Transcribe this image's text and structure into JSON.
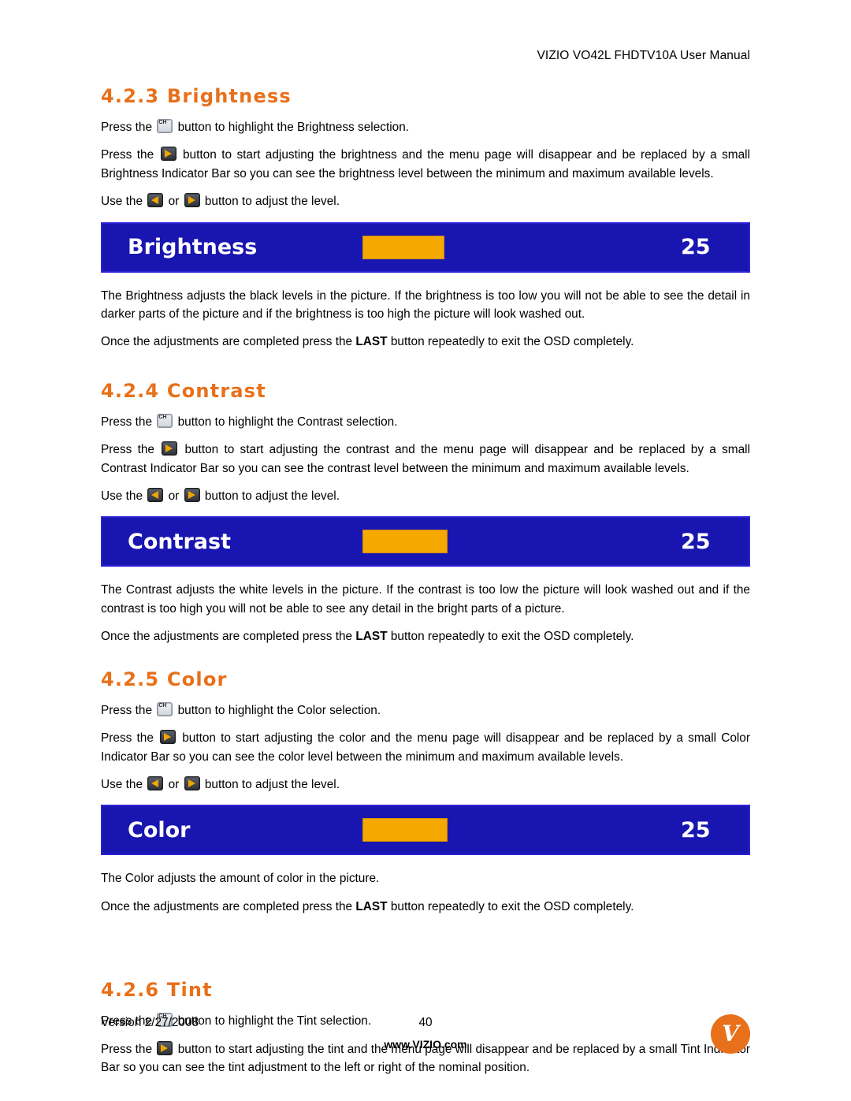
{
  "header": {
    "title": "VIZIO VO42L FHDTV10A User Manual"
  },
  "sections": [
    {
      "number_title": "4.2.3 Brightness",
      "p1_a": "Press the",
      "p1_b": "button to highlight the Brightness selection.",
      "p2_a": "Press the",
      "p2_b": "button to start adjusting the brightness and the menu page will disappear and be replaced by a small Brightness Indicator Bar so you can see the brightness level between the minimum and maximum available levels.",
      "p3_a": "Use the",
      "p3_or": "or",
      "p3_b": "button to adjust the level.",
      "osd": {
        "label": "Brightness",
        "value": "25",
        "fill_percent": 27
      },
      "p4": "The Brightness adjusts the black levels in the picture.  If the brightness is too low you will not be able to see the detail in darker parts of the picture and if the brightness is too high the picture will look washed out.",
      "p5_a": "Once the adjustments are completed press the",
      "p5_bold": "LAST",
      "p5_b": "button repeatedly to exit the OSD completely."
    },
    {
      "number_title": "4.2.4 Contrast",
      "p1_a": "Press the",
      "p1_b": "button to highlight the Contrast selection.",
      "p2_a": "Press the",
      "p2_b": "button to start adjusting the contrast and the menu page will disappear and be replaced by a small Contrast Indicator Bar so you can see the contrast level between the minimum and maximum available levels.",
      "p3_a": "Use the",
      "p3_or": "or",
      "p3_b": "button to adjust the level.",
      "osd": {
        "label": "Contrast",
        "value": "25",
        "fill_percent": 28
      },
      "p4": "The Contrast adjusts the white levels in the picture.  If the contrast is too low the picture will look washed out and if the contrast is too high you will not be able to see any detail in the bright parts of a picture.",
      "p5_a": "Once the adjustments are completed press the",
      "p5_bold": "LAST",
      "p5_b": "button repeatedly to exit the OSD completely."
    },
    {
      "number_title": "4.2.5 Color",
      "p1_a": "Press the",
      "p1_b": "button to highlight the Color selection.",
      "p2_a": "Press the",
      "p2_b": "button to start adjusting the color and the menu page will disappear and be replaced by a small Color Indicator Bar so you can see the color level between the minimum and maximum available levels.",
      "p3_a": "Use the",
      "p3_or": "or",
      "p3_b": "button to adjust the level.",
      "osd": {
        "label": "Color",
        "value": "25",
        "fill_percent": 28
      },
      "p4": "The Color adjusts the amount of color in the picture.",
      "p5_a": "Once the adjustments are completed press the",
      "p5_bold": "LAST",
      "p5_b": "button repeatedly to exit the OSD completely."
    },
    {
      "number_title": "4.2.6 Tint",
      "p1_a": "Press the",
      "p1_b": "button to highlight the Tint selection.",
      "p2_a": "Press the",
      "p2_b": "button to start adjusting the tint and the menu page will disappear and be replaced by a small Tint Indicator Bar so you can see the tint adjustment to the left or right of the nominal position."
    }
  ],
  "footer": {
    "version": "Version 2/27/2008",
    "page": "40",
    "website": "www.VIZIO.com",
    "logo_letter": "V"
  },
  "colors": {
    "heading": "#E8701A",
    "osd_background": "#1915B0",
    "osd_fill": "#F5A800",
    "logo": "#E8701A"
  }
}
